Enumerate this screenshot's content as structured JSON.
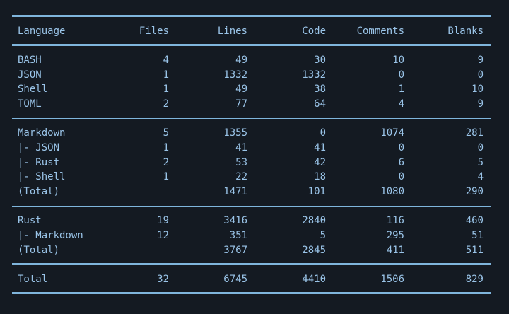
{
  "table": {
    "headers": {
      "language": "Language",
      "files": "Files",
      "lines": "Lines",
      "code": "Code",
      "comments": "Comments",
      "blanks": "Blanks"
    },
    "sections": [
      {
        "rows": [
          {
            "language": "BASH",
            "files": "4",
            "lines": "49",
            "code": "30",
            "comments": "10",
            "blanks": "9"
          },
          {
            "language": "JSON",
            "files": "1",
            "lines": "1332",
            "code": "1332",
            "comments": "0",
            "blanks": "0"
          },
          {
            "language": "Shell",
            "files": "1",
            "lines": "49",
            "code": "38",
            "comments": "1",
            "blanks": "10"
          },
          {
            "language": "TOML",
            "files": "2",
            "lines": "77",
            "code": "64",
            "comments": "4",
            "blanks": "9"
          }
        ]
      },
      {
        "rows": [
          {
            "language": "Markdown",
            "files": "5",
            "lines": "1355",
            "code": "0",
            "comments": "1074",
            "blanks": "281"
          },
          {
            "language": "|- JSON",
            "files": "1",
            "lines": "41",
            "code": "41",
            "comments": "0",
            "blanks": "0"
          },
          {
            "language": "|- Rust",
            "files": "2",
            "lines": "53",
            "code": "42",
            "comments": "6",
            "blanks": "5"
          },
          {
            "language": "|- Shell",
            "files": "1",
            "lines": "22",
            "code": "18",
            "comments": "0",
            "blanks": "4"
          },
          {
            "language": "(Total)",
            "files": "",
            "lines": "1471",
            "code": "101",
            "comments": "1080",
            "blanks": "290"
          }
        ]
      },
      {
        "rows": [
          {
            "language": "Rust",
            "files": "19",
            "lines": "3416",
            "code": "2840",
            "comments": "116",
            "blanks": "460"
          },
          {
            "language": "|- Markdown",
            "files": "12",
            "lines": "351",
            "code": "5",
            "comments": "295",
            "blanks": "51"
          },
          {
            "language": "(Total)",
            "files": "",
            "lines": "3767",
            "code": "2845",
            "comments": "411",
            "blanks": "511"
          }
        ]
      }
    ],
    "total": {
      "language": "Total",
      "files": "32",
      "lines": "6745",
      "code": "4410",
      "comments": "1506",
      "blanks": "829"
    }
  },
  "colors": {
    "background": "#141a22",
    "text": "#9ac4e8",
    "rule": "#7fb5dc"
  }
}
